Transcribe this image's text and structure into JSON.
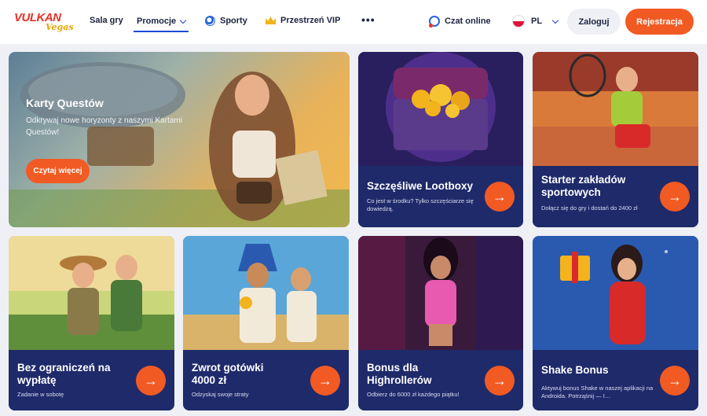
{
  "header": {
    "logo_text_1": "VULKAN",
    "logo_text_2": "Vegas",
    "nav": {
      "sala_gry": "Sala gry",
      "promocje": "Promocje",
      "sporty": "Sporty",
      "vip": "Przestrzeń VIP",
      "more": "•••"
    },
    "chat": "Czat online",
    "language": "PL",
    "login": "Zaloguj",
    "register": "Rejestracja"
  },
  "hero": {
    "title": "Karty Questów",
    "subtitle": "Odkrywaj nowe horyzonty z naszymi Kartami Questów!",
    "button": "Czytaj więcej"
  },
  "cards": [
    {
      "title": "Szczęśliwe Lootboxy",
      "subtitle": "Co jest w środku? Tylko szczęściarze się dowiedzą.",
      "arrow": "→"
    },
    {
      "title": "Starter zakładów sportowych",
      "subtitle": "Dołącz się do gry i dostań do 2400 zł",
      "arrow": "→"
    },
    {
      "title": "Bez ograniczeń na wypłatę",
      "subtitle": "Zadanie w sobotę",
      "arrow": "→"
    },
    {
      "title": "Zwrot gotówki 4000 zł",
      "subtitle": "Odzyskaj swoje straty",
      "arrow": "→"
    },
    {
      "title": "Bonus dla Highrollerów",
      "subtitle": "Odbierz do 6000 zł każdego piątku!",
      "arrow": "→"
    },
    {
      "title": "Shake Bonus",
      "subtitle": "Aktywuj bonus Shake w naszej aplikacji na Androida. Potrząśnij — I…",
      "arrow": "→"
    }
  ],
  "colors": {
    "accent": "#f25a23",
    "card_panel": "#1f2a6b",
    "nav_active": "#1c4bd9"
  }
}
